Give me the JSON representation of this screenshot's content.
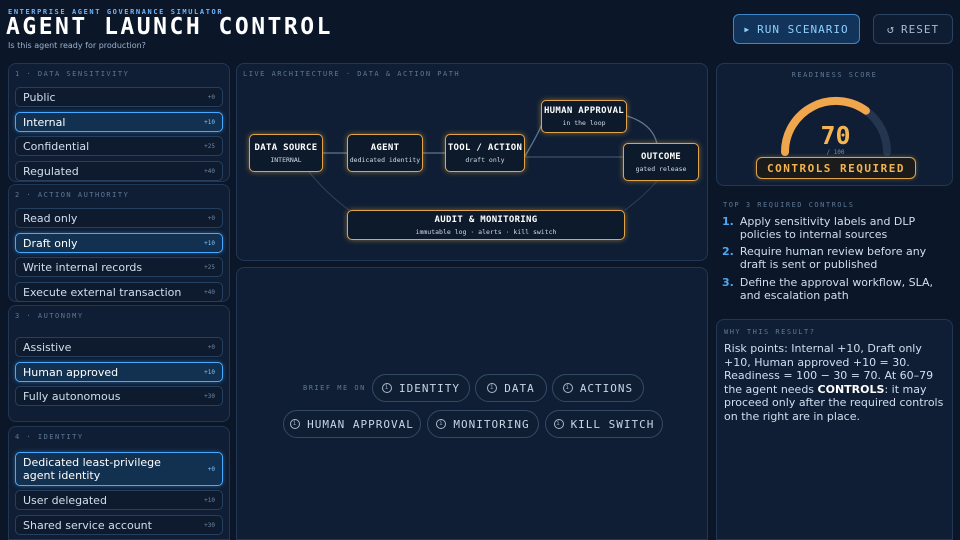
{
  "header": {
    "eyebrow": "ENTERPRISE AGENT GOVERNANCE SIMULATOR",
    "title": "AGENT LAUNCH CONTROL",
    "subtitle": "Is this agent ready for production?",
    "run_label": "RUN SCENARIO",
    "reset_label": "RESET"
  },
  "groups": [
    {
      "label": "1 · DATA SENSITIVITY",
      "options": [
        {
          "label": "Public",
          "points": "+0",
          "selected": false
        },
        {
          "label": "Internal",
          "points": "+10",
          "selected": true
        },
        {
          "label": "Confidential",
          "points": "+25",
          "selected": false
        },
        {
          "label": "Regulated",
          "points": "+40",
          "selected": false
        }
      ]
    },
    {
      "label": "2 · ACTION AUTHORITY",
      "options": [
        {
          "label": "Read only",
          "points": "+0",
          "selected": false
        },
        {
          "label": "Draft only",
          "points": "+10",
          "selected": true
        },
        {
          "label": "Write internal records",
          "points": "+25",
          "selected": false
        },
        {
          "label": "Execute external transaction",
          "points": "+40",
          "selected": false
        }
      ]
    },
    {
      "label": "3 · AUTONOMY",
      "options": [
        {
          "label": "Assistive",
          "points": "+0",
          "selected": false
        },
        {
          "label": "Human approved",
          "points": "+10",
          "selected": true
        },
        {
          "label": "Fully autonomous",
          "points": "+30",
          "selected": false
        }
      ]
    },
    {
      "label": "4 · IDENTITY",
      "options": [
        {
          "label": "Dedicated least-privilege agent identity",
          "points": "+0",
          "selected": true
        },
        {
          "label": "User delegated",
          "points": "+10",
          "selected": false
        },
        {
          "label": "Shared service account",
          "points": "+30",
          "selected": false
        }
      ]
    }
  ],
  "architecture": {
    "label": "LIVE ARCHITECTURE · DATA & ACTION PATH",
    "nodes": {
      "data_source": {
        "title": "DATA SOURCE",
        "sub": "INTERNAL"
      },
      "agent": {
        "title": "AGENT",
        "sub": "dedicated identity"
      },
      "tool": {
        "title": "TOOL / ACTION",
        "sub": "draft only"
      },
      "approval": {
        "title": "HUMAN APPROVAL",
        "sub": "in the loop"
      },
      "outcome": {
        "title": "OUTCOME",
        "sub": "gated release"
      },
      "audit": {
        "title": "AUDIT & MONITORING",
        "sub": "immutable log · alerts · kill switch"
      }
    }
  },
  "brief": {
    "label": "BRIEF ME ON",
    "chips": [
      "IDENTITY",
      "DATA",
      "ACTIONS",
      "HUMAN APPROVAL",
      "MONITORING",
      "KILL SWITCH"
    ],
    "icon": "i"
  },
  "readiness": {
    "label": "READINESS SCORE",
    "score": "70",
    "max": "/ 100",
    "value": 70,
    "status": "CONTROLS REQUIRED",
    "gauge_color": "#f0a64c",
    "track_color": "#24364f"
  },
  "controls": {
    "label": "TOP 3 REQUIRED CONTROLS",
    "items": [
      {
        "n": "1.",
        "text": "Apply sensitivity labels and DLP policies to internal sources"
      },
      {
        "n": "2.",
        "text": "Require human review before any draft is sent or published"
      },
      {
        "n": "3.",
        "text": "Define the approval workflow, SLA, and escalation path"
      }
    ]
  },
  "why": {
    "label": "WHY THIS RESULT?",
    "text_a": "Risk points: Internal +10, Draft only +10, Human approved +10 = 30. Readiness = 100 − 30 = 70. At 60–79 the agent needs ",
    "bold": "CONTROLS",
    "text_b": ": it may proceed only after the required controls on the right are in place."
  },
  "colors": {
    "accent": "#46a8ff",
    "warning": "#e2a448",
    "background": "#0b1628"
  }
}
